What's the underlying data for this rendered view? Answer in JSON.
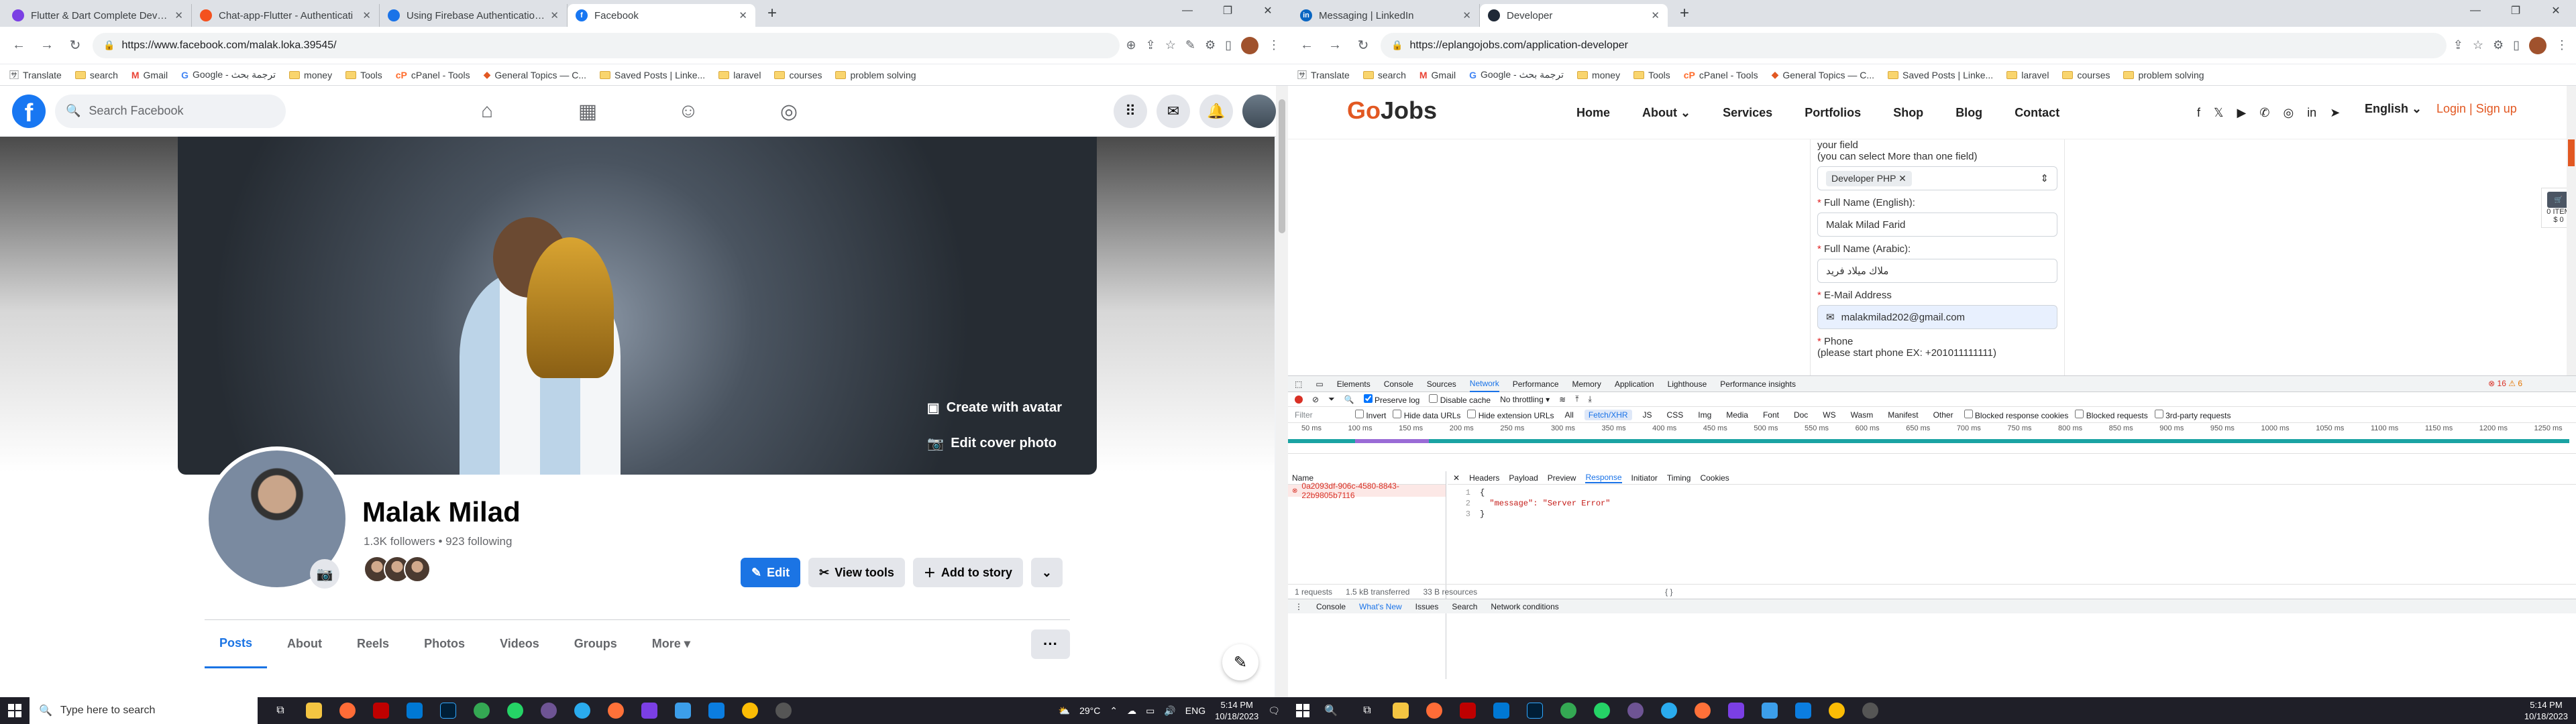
{
  "left_browser": {
    "tabs": [
      {
        "title": "Flutter & Dart Complete Develo",
        "color": "#7b3fe4",
        "active": false
      },
      {
        "title": "Chat-app-Flutter - Authenticati",
        "color": "#f4511e",
        "active": false
      },
      {
        "title": "Using Firebase Authentication |",
        "color": "#1a73e8",
        "active": false
      },
      {
        "title": "Facebook",
        "color": "#1877f2",
        "active": true
      }
    ],
    "url": "https://www.facebook.com/malak.loka.39545/",
    "bookmarks": [
      "Translate",
      "search",
      "Gmail",
      "Google - ترجمة بحث",
      "money",
      "Tools",
      "cPanel - Tools",
      "General Topics — C...",
      "Saved Posts | Linke...",
      "laravel",
      "courses",
      "problem solving"
    ]
  },
  "facebook": {
    "search_placeholder": "Search Facebook",
    "profile_name": "Malak Milad",
    "stats": "1.3K followers • 923 following",
    "create_avatar": "Create with avatar",
    "edit_cover": "Edit cover photo",
    "btn_edit": "Edit",
    "btn_view_tools": "View tools",
    "btn_add_story": "Add to story",
    "tabs": [
      "Posts",
      "About",
      "Reels",
      "Photos",
      "Videos",
      "Groups",
      "More"
    ]
  },
  "right_browser": {
    "tabs": [
      {
        "title": "Messaging | LinkedIn",
        "color": "#0a66c2",
        "active": false
      },
      {
        "title": "Developer",
        "color": "#1f2937",
        "active": true
      }
    ],
    "url": "https://eplangojobs.com/application-developer",
    "bookmarks": [
      "Translate",
      "search",
      "Gmail",
      "Google - ترجمة بحث",
      "money",
      "Tools",
      "cPanel - Tools",
      "General Topics — C...",
      "Saved Posts | Linke...",
      "laravel",
      "courses",
      "problem solving"
    ]
  },
  "gojobs": {
    "logo_g": "Go",
    "logo_rest": "Jobs",
    "nav": [
      "Home",
      "About",
      "Services",
      "Portfolios",
      "Shop",
      "Blog",
      "Contact"
    ],
    "lang": "English",
    "login": "Login | Sign up",
    "field_label_partial": "your field",
    "field_hint": "(you can select More than one field)",
    "field_chip": "Developer PHP",
    "full_name_en_label": "Full Name (English):",
    "full_name_en": "Malak Milad Farid",
    "full_name_ar_label": "Full Name (Arabic):",
    "full_name_ar": "ملاك ميلاد فريد",
    "email_label": "E-Mail Address",
    "email": "malakmilad202@gmail.com",
    "phone_label": "Phone",
    "phone_hint": "(please start phone EX: +201011111111)",
    "cart_label": "0 ITEM",
    "cart_price": "$ 0"
  },
  "devtools": {
    "tabs": [
      "Elements",
      "Console",
      "Sources",
      "Network",
      "Performance",
      "Memory",
      "Application",
      "Lighthouse",
      "Performance insights"
    ],
    "active_tab": "Network",
    "errors": "16",
    "warnings": "6",
    "preserve_log": "Preserve log",
    "disable_cache": "Disable cache",
    "throttling": "No throttling",
    "filter_placeholder": "Filter",
    "invert": "Invert",
    "hide_data_urls": "Hide data URLs",
    "hide_ext_urls": "Hide extension URLs",
    "type_filters": [
      "All",
      "Fetch/XHR",
      "JS",
      "CSS",
      "Img",
      "Media",
      "Font",
      "Doc",
      "WS",
      "Wasm",
      "Manifest",
      "Other"
    ],
    "active_type": "Fetch/XHR",
    "blocked_cookies": "Blocked response cookies",
    "blocked_requests": "Blocked requests",
    "third_party": "3rd-party requests",
    "timeline_ticks": [
      "50 ms",
      "100 ms",
      "150 ms",
      "200 ms",
      "250 ms",
      "300 ms",
      "350 ms",
      "400 ms",
      "450 ms",
      "500 ms",
      "550 ms",
      "600 ms",
      "650 ms",
      "700 ms",
      "750 ms",
      "800 ms",
      "850 ms",
      "900 ms",
      "950 ms",
      "1000 ms",
      "1050 ms",
      "1100 ms",
      "1150 ms",
      "1200 ms",
      "1250 ms"
    ],
    "col_name": "Name",
    "request_name": "0a2093df-906c-4580-8843-22b9805b7116",
    "resp_tabs": [
      "Headers",
      "Payload",
      "Preview",
      "Response",
      "Initiator",
      "Timing",
      "Cookies"
    ],
    "active_resp_tab": "Response",
    "code_lines": [
      "{",
      "  \"message\": \"Server Error\"",
      "}"
    ],
    "status": [
      "1 requests",
      "1.5 kB transferred",
      "33 B resources"
    ],
    "drawer_tabs": [
      "Console",
      "What's New",
      "Issues",
      "Search",
      "Network conditions"
    ]
  },
  "taskbar": {
    "search_placeholder": "Type here to search",
    "weather": "29°C",
    "lang": "ENG",
    "time": "5:14 PM",
    "date": "10/18/2023"
  }
}
